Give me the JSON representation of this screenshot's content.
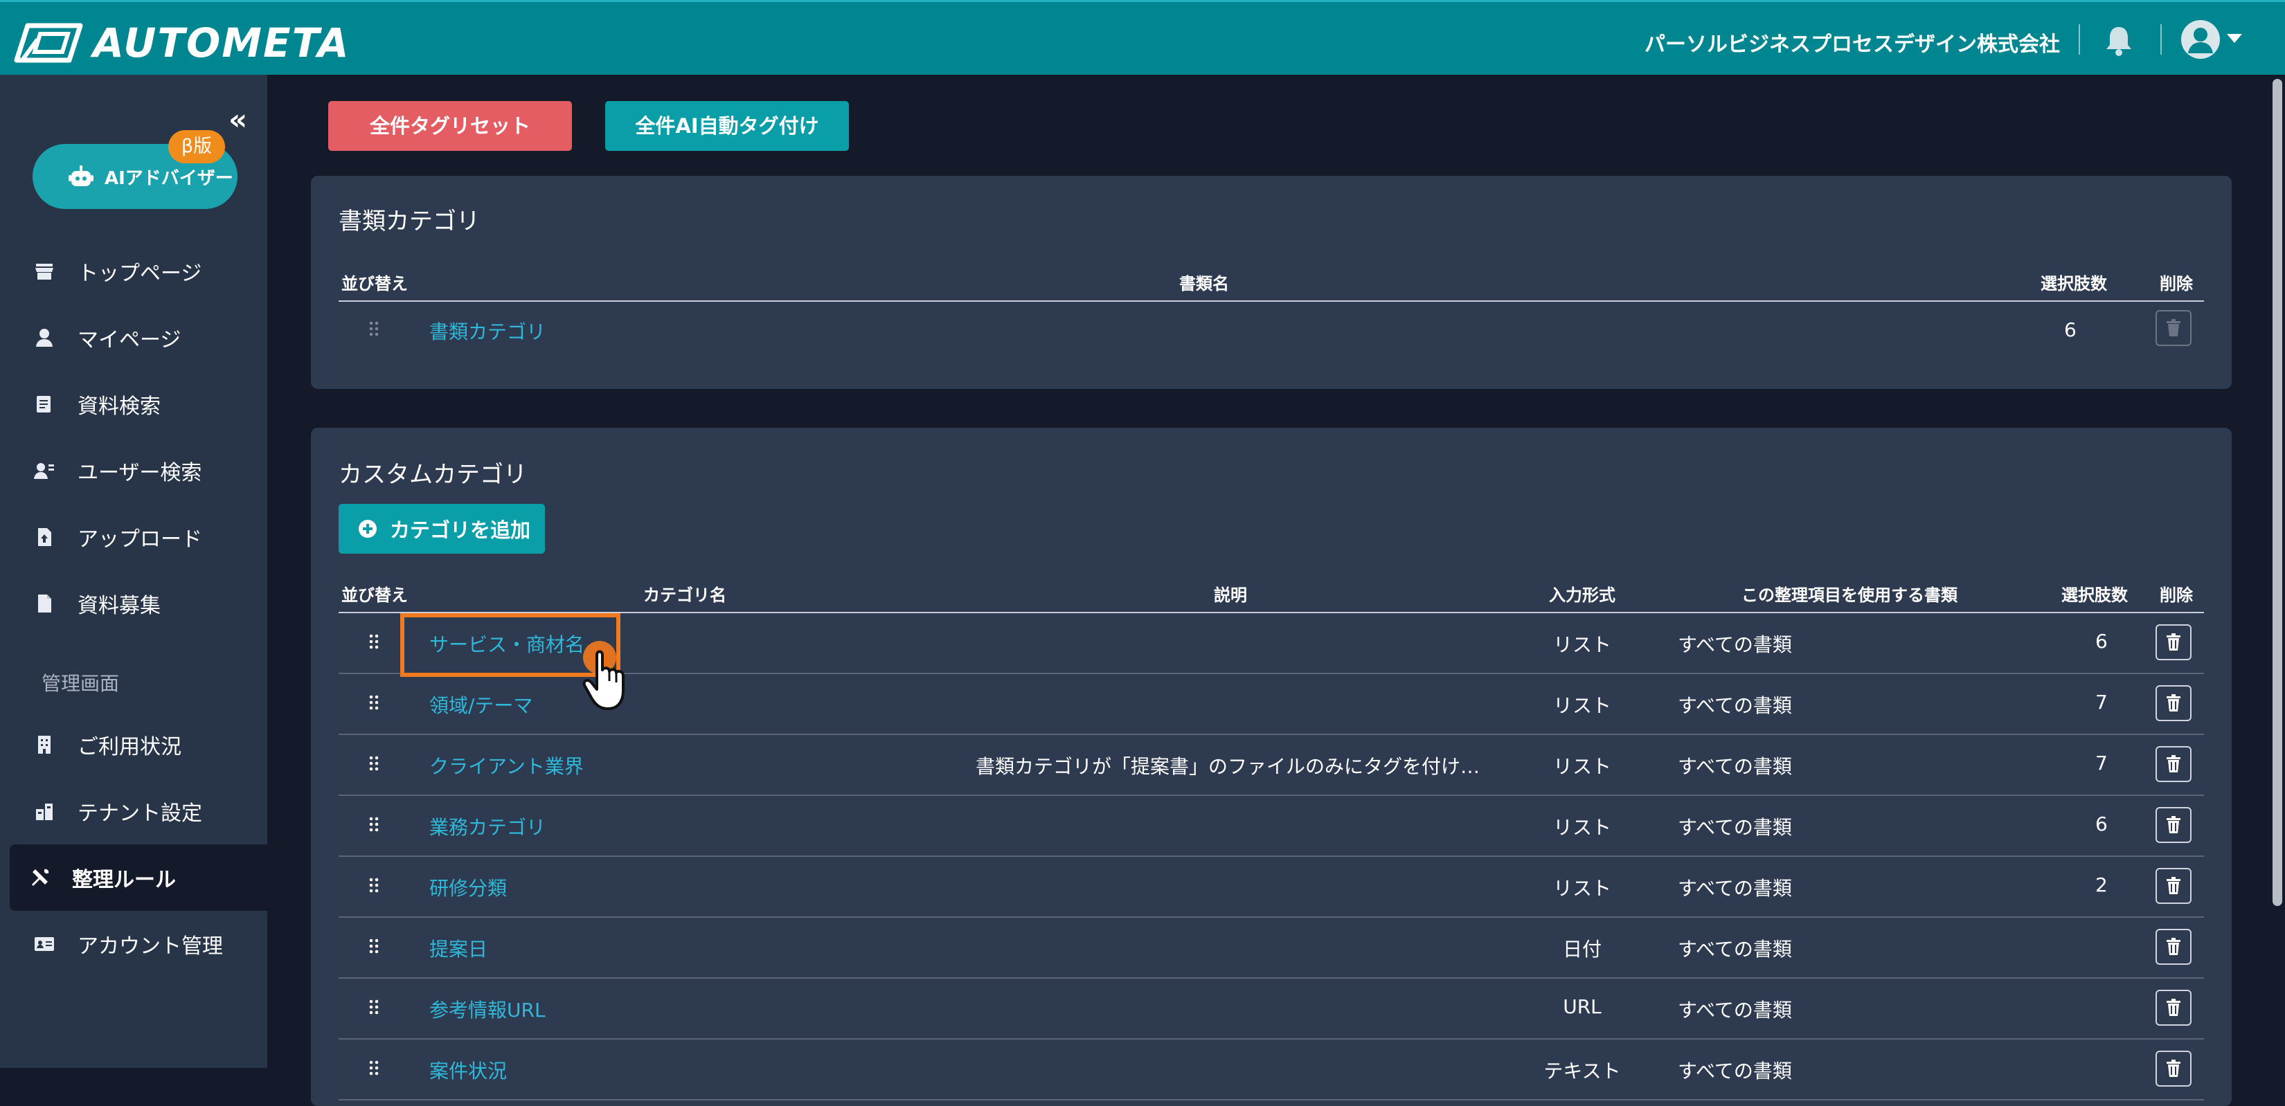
{
  "header": {
    "logo_text": "AUTOMETA",
    "company": "パーソルビジネスプロセスデザイン株式会社",
    "icons": [
      "logo-icon",
      "bell-icon",
      "user-avatar-icon",
      "caret-down-icon"
    ]
  },
  "sidebar": {
    "collapse_glyph": "«",
    "ai_advisor": {
      "label": "AIアドバイザー",
      "badge": "β版"
    },
    "items": [
      {
        "label": "トップページ",
        "icon": "store-icon"
      },
      {
        "label": "マイページ",
        "icon": "person-icon"
      },
      {
        "label": "資料検索",
        "icon": "document-search-icon"
      },
      {
        "label": "ユーザー検索",
        "icon": "user-search-icon"
      },
      {
        "label": "アップロード",
        "icon": "upload-file-icon"
      },
      {
        "label": "資料募集",
        "icon": "file-icon"
      }
    ],
    "admin_section": "管理画面",
    "admin_items": [
      {
        "label": "ご利用状況",
        "icon": "building-icon"
      },
      {
        "label": "テナント設定",
        "icon": "tenant-icon"
      },
      {
        "label": "整理ルール",
        "icon": "tools-icon",
        "active": true
      },
      {
        "label": "アカウント管理",
        "icon": "id-card-icon"
      }
    ]
  },
  "actions": {
    "reset_all_tags": "全件タグリセット",
    "ai_auto_tag_all": "全件AI自動タグ付け"
  },
  "doc_category": {
    "title": "書類カテゴリ",
    "headers": {
      "sort": "並び替え",
      "name": "書類名",
      "choices": "選択肢数",
      "delete": "削除"
    },
    "rows": [
      {
        "name": "書類カテゴリ",
        "choices": "6"
      }
    ]
  },
  "custom_category": {
    "title": "カスタムカテゴリ",
    "add_button": "カテゴリを追加",
    "headers": {
      "sort": "並び替え",
      "name": "カテゴリ名",
      "description": "説明",
      "input_type": "入力形式",
      "used_docs": "この整理項目を使用する書類",
      "choices": "選択肢数",
      "delete": "削除"
    },
    "rows": [
      {
        "name": "サービス・商材名",
        "description": "",
        "input_type": "リスト",
        "used_docs": "すべての書類",
        "choices": "6"
      },
      {
        "name": "領域/テーマ",
        "description": "",
        "input_type": "リスト",
        "used_docs": "すべての書類",
        "choices": "7"
      },
      {
        "name": "クライアント業界",
        "description": "書類カテゴリが「提案書」のファイルのみにタグを付け…",
        "input_type": "リスト",
        "used_docs": "すべての書類",
        "choices": "7"
      },
      {
        "name": "業務カテゴリ",
        "description": "",
        "input_type": "リスト",
        "used_docs": "すべての書類",
        "choices": "6"
      },
      {
        "name": "研修分類",
        "description": "",
        "input_type": "リスト",
        "used_docs": "すべての書類",
        "choices": "2"
      },
      {
        "name": "提案日",
        "description": "",
        "input_type": "日付",
        "used_docs": "すべての書類",
        "choices": ""
      },
      {
        "name": "参考情報URL",
        "description": "",
        "input_type": "URL",
        "used_docs": "すべての書類",
        "choices": ""
      },
      {
        "name": "案件状況",
        "description": "",
        "input_type": "テキスト",
        "used_docs": "すべての書類",
        "choices": ""
      }
    ]
  },
  "colors": {
    "header": "#008690",
    "sidebar": "#283549",
    "background": "#141a29",
    "panel": "#2e3a50",
    "accent": "#0a9ea8",
    "danger": "#e35d63",
    "link": "#2fb8d9",
    "highlight": "#f27a1e",
    "beta_badge": "#f08c1c"
  }
}
